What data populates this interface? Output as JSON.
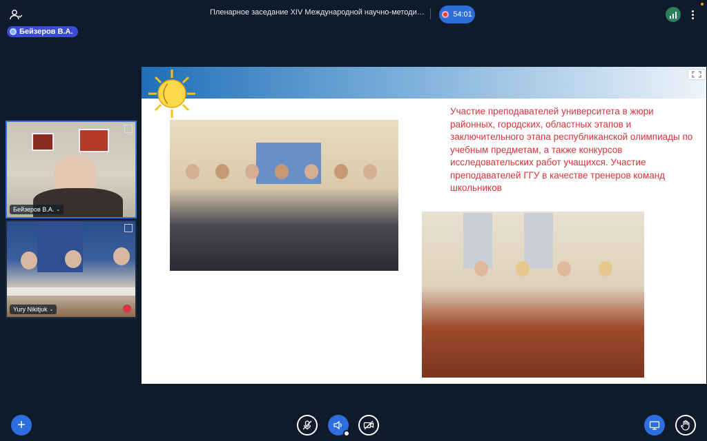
{
  "header": {
    "meeting_title": "Пленарное заседание XIV Международной научно-методической ...",
    "timer": "54:01",
    "active_speaker": "Бейзеров В.А."
  },
  "tiles": [
    {
      "name": "Бейзеров В.А."
    },
    {
      "name": "Yury Nikitjuk"
    }
  ],
  "slide": {
    "text": "Участие преподавателей университета в жюри районных, городских, областных этапов и заключительного этапа республиканской олимпиады по учебным предметам, а также конкурсов исследовательских работ учащихся. Участие преподавателей ГГУ в качестве тренеров команд школьников"
  },
  "toolbar": {
    "add_label": "+"
  },
  "colors": {
    "background": "#0f1b2a",
    "accent": "#2e6fe0",
    "slide_text": "#d8343a",
    "record": "#e53945"
  },
  "icons": [
    "participants-icon",
    "record-icon",
    "signal-icon",
    "more-icon",
    "expand-icon",
    "mic-off-icon",
    "microphone-icon",
    "speaker-icon",
    "camera-off-icon",
    "screen-share-icon",
    "raise-hand-icon",
    "fullscreen-icon"
  ]
}
